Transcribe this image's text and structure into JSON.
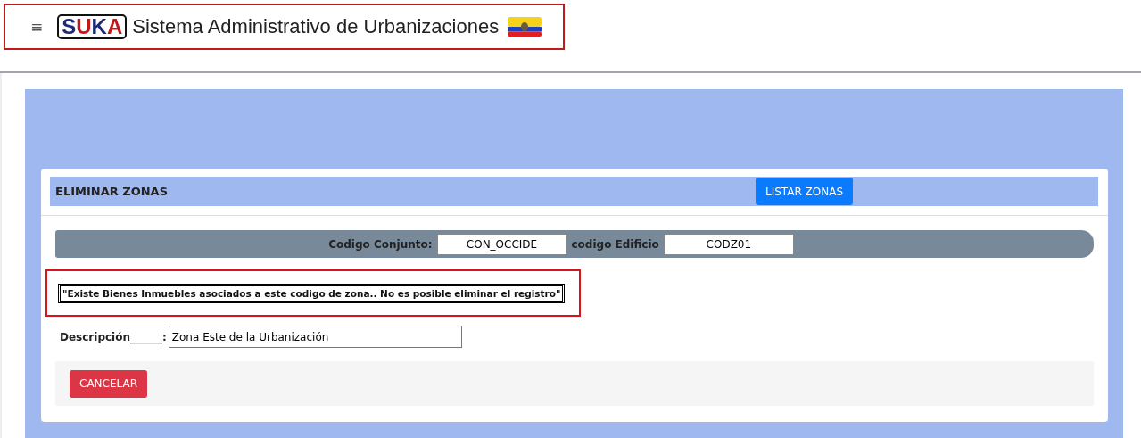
{
  "header": {
    "menu_icon": "≡",
    "logo": "SUKA",
    "title": "Sistema Administrativo de Urbanizaciones"
  },
  "card": {
    "title": "ELIMINAR ZONAS",
    "list_button": "LISTAR ZONAS",
    "codes": [
      {
        "label": "Codigo Conjunto:",
        "value": "CON_OCCIDE"
      },
      {
        "label": "codigo Edificio",
        "value": "CODZ01"
      }
    ],
    "message": "\"Existe Bienes Inmuebles asociados a este codigo de zona.. No es posible eliminar el registro\"",
    "description": {
      "label": "Descripción______:",
      "value": "Zona Este de la Urbanización"
    },
    "cancel_button": "CANCELAR"
  }
}
